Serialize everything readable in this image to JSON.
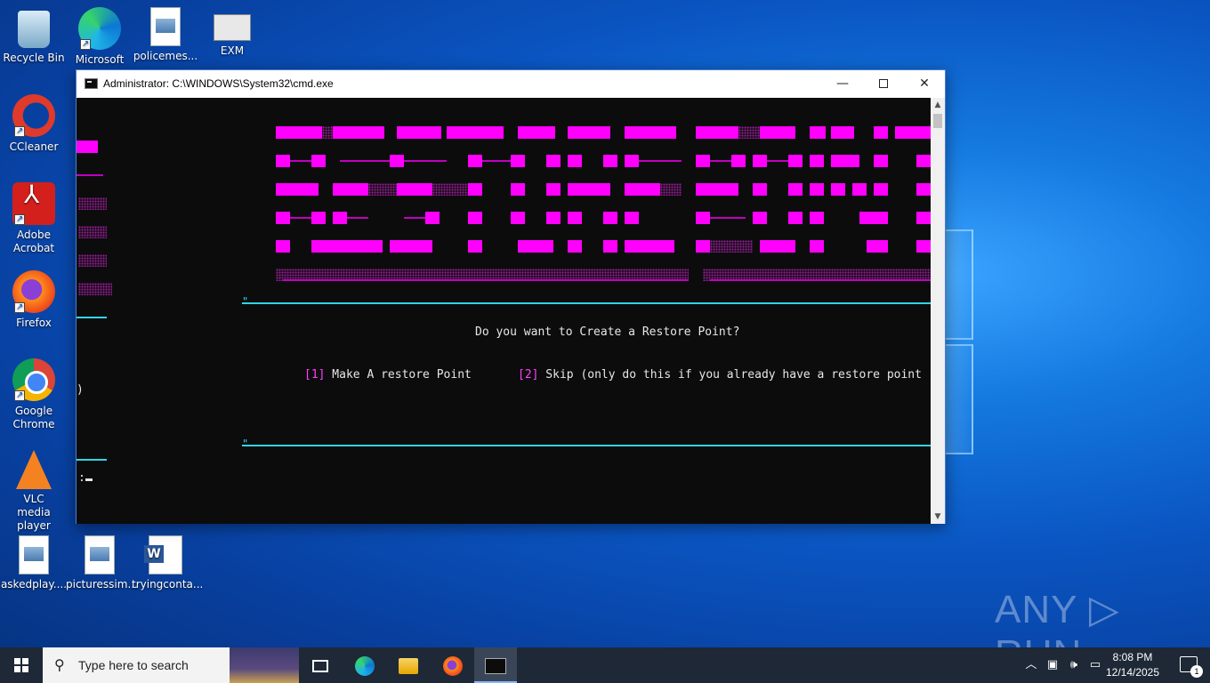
{
  "desktop": {
    "icons": [
      {
        "label": "Recycle Bin"
      },
      {
        "label": "Microsoft Edge"
      },
      {
        "label": "policemes..."
      },
      {
        "label": "EXM Premium Install"
      },
      {
        "label": "CCleaner"
      },
      {
        "label": "Adobe Acrobat"
      },
      {
        "label": "Firefox"
      },
      {
        "label": "Google Chrome"
      },
      {
        "label": "VLC media player"
      },
      {
        "label": "askedplay...."
      },
      {
        "label": "picturessim..."
      },
      {
        "label": "tryingconta..."
      }
    ]
  },
  "cmd": {
    "title": "Administrator: C:\\WINDOWS\\System32\\cmd.exe",
    "question": "Do you want to Create a Restore Point?",
    "option1_num": "[1]",
    "option1_text": " Make A restore Point",
    "option2_num": "[2]",
    "option2_text": " Skip (only do this if you already have a restore point",
    "wrap_paren": ")",
    "prompt": ":",
    "rule_tick": "\"",
    "colors": {
      "banner": "#ff00ff",
      "rule": "#2fd6e6",
      "text": "#e6e6e6"
    }
  },
  "watermark": "ANY ▷ RUN",
  "taskbar": {
    "search_placeholder": "Type here to search",
    "time": "8:08 PM",
    "date": "12/14/2025",
    "notification_count": "1"
  }
}
